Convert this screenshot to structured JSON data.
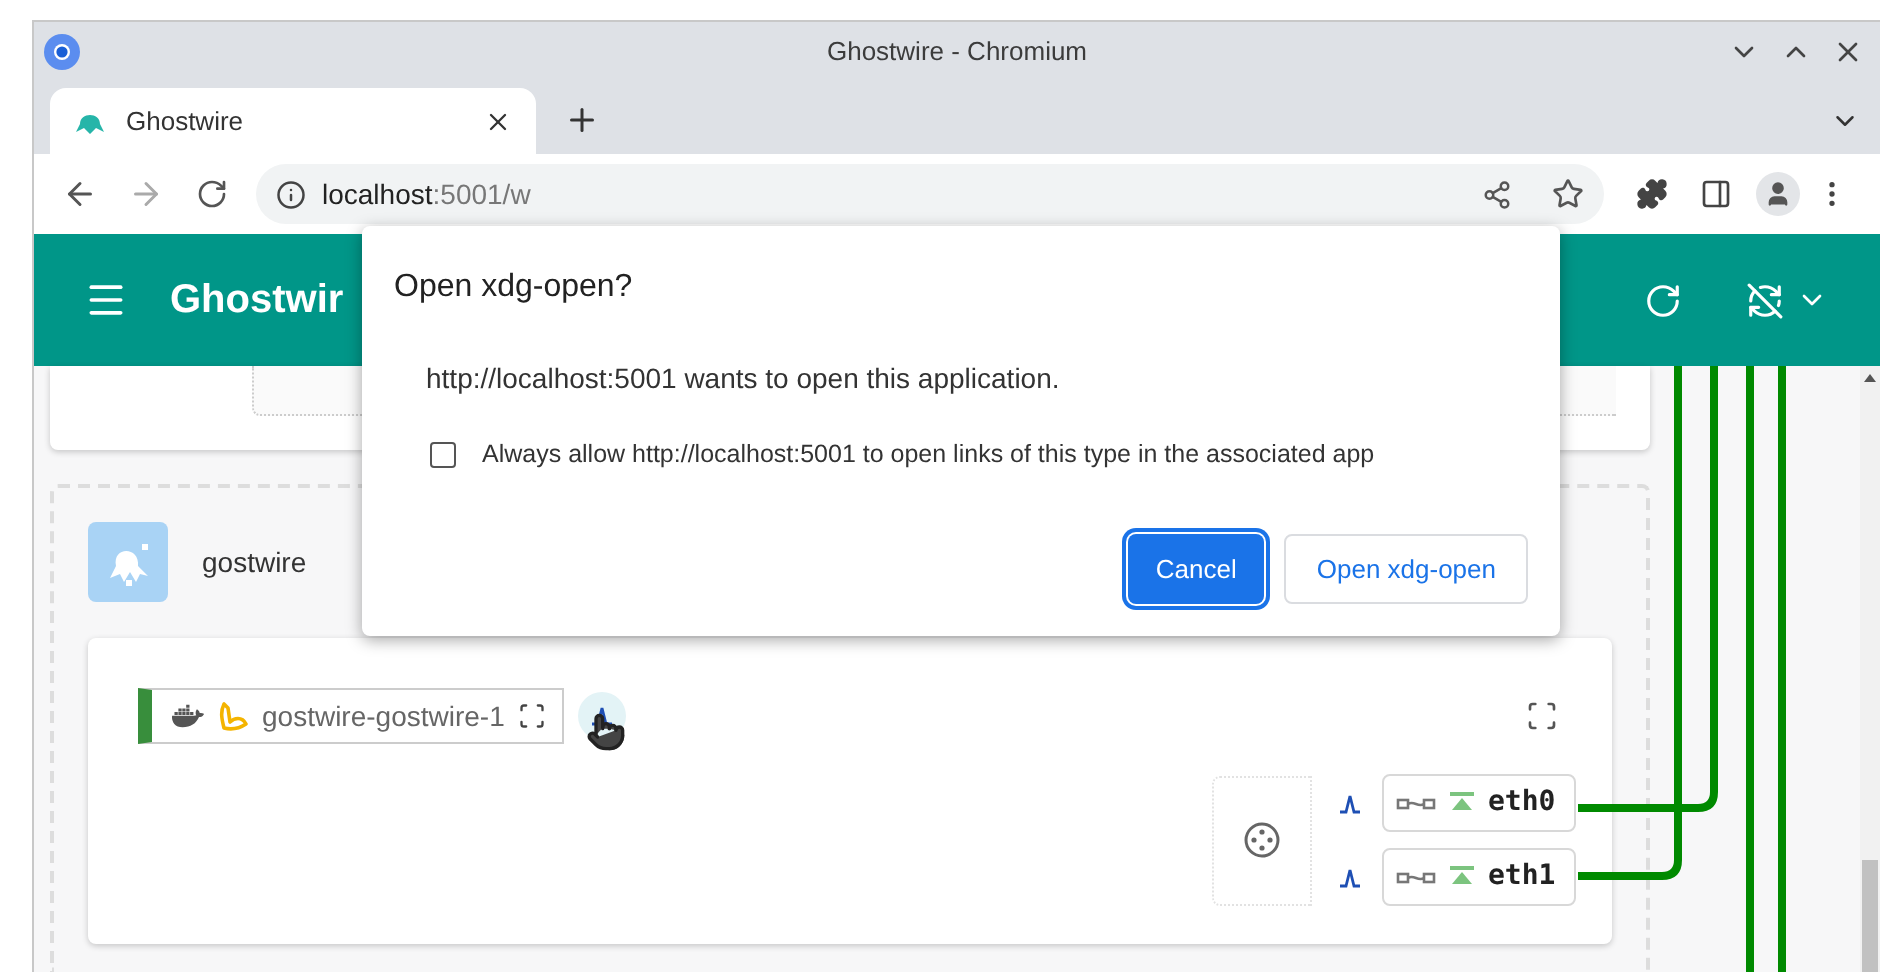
{
  "window": {
    "title": "Ghostwire - Chromium"
  },
  "tabs": [
    {
      "label": "Ghostwire",
      "selected": true
    }
  ],
  "address_bar": {
    "host": "localhost",
    "path": ":5001/w"
  },
  "app_bar": {
    "title": "Ghostwir"
  },
  "project": {
    "name": "gostwire"
  },
  "container": {
    "name": "gostwire-gostwire-1"
  },
  "interfaces": [
    {
      "name": "eth0"
    },
    {
      "name": "eth1"
    }
  ],
  "dialog": {
    "title": "Open xdg-open?",
    "message": "http://localhost:5001 wants to open this application.",
    "checkbox": {
      "label": "Always allow http://localhost:5001 to open links of this type in the associated app",
      "checked": false
    },
    "buttons": [
      {
        "label": "Cancel",
        "kind": "primary"
      },
      {
        "label": "Open xdg-open",
        "kind": "secondary"
      }
    ]
  }
}
